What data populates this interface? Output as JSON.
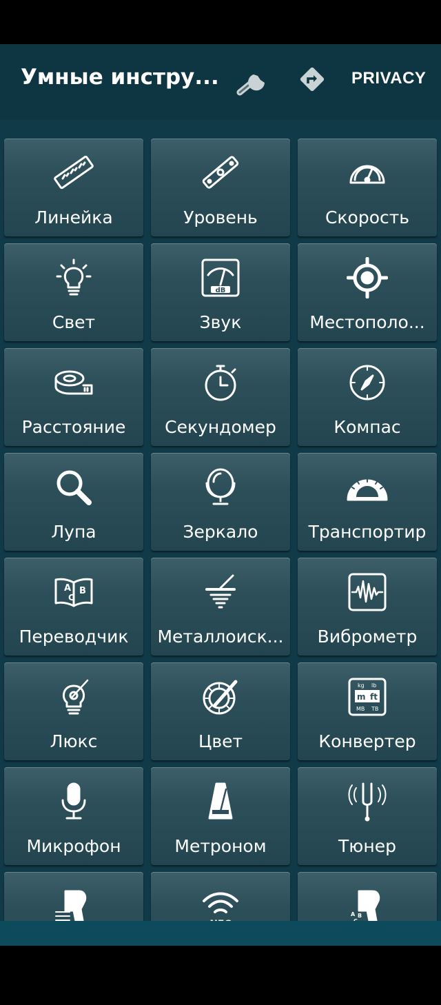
{
  "toolbar": {
    "title": "Умные инстру...",
    "settings_icon": "wrench-icon",
    "directions_icon": "directions-icon",
    "privacy_label": "PRIVACY"
  },
  "tools": [
    {
      "label": "Линейка",
      "icon": "ruler-icon"
    },
    {
      "label": "Уровень",
      "icon": "level-icon"
    },
    {
      "label": "Скорость",
      "icon": "speedometer-icon"
    },
    {
      "label": "Свет",
      "icon": "lightbulb-icon"
    },
    {
      "label": "Звук",
      "icon": "sound-meter-icon"
    },
    {
      "label": "Местополо...",
      "icon": "location-icon"
    },
    {
      "label": "Расстояние",
      "icon": "tape-measure-icon"
    },
    {
      "label": "Секундомер",
      "icon": "stopwatch-icon"
    },
    {
      "label": "Компас",
      "icon": "compass-icon"
    },
    {
      "label": "Лупа",
      "icon": "magnifier-icon"
    },
    {
      "label": "Зеркало",
      "icon": "mirror-icon"
    },
    {
      "label": "Транспортир",
      "icon": "protractor-icon"
    },
    {
      "label": "Переводчик",
      "icon": "translator-book-icon"
    },
    {
      "label": "Металлоиск...",
      "icon": "metal-detector-icon"
    },
    {
      "label": "Виброметр",
      "icon": "vibrometer-icon"
    },
    {
      "label": "Люкс",
      "icon": "lux-meter-icon"
    },
    {
      "label": "Цвет",
      "icon": "color-picker-icon"
    },
    {
      "label": "Конвертер",
      "icon": "converter-icon"
    },
    {
      "label": "Микрофон",
      "icon": "microphone-icon"
    },
    {
      "label": "Метроном",
      "icon": "metronome-icon"
    },
    {
      "label": "Тюнер",
      "icon": "tuning-fork-icon"
    },
    {
      "label": "",
      "icon": "barcode-scanner-icon"
    },
    {
      "label": "",
      "icon": "nfc-icon"
    },
    {
      "label": "",
      "icon": "text-scanner-icon"
    }
  ],
  "icon_texts": {
    "sound_unit": "dB",
    "nfc": "NFC",
    "book_a": "A",
    "book_b": "B",
    "book_c": "C",
    "conv_kg": "kg",
    "conv_lb": "lb",
    "conv_m": "m",
    "conv_ft": "ft",
    "conv_mb": "MB",
    "conv_tb": "TB"
  },
  "colors": {
    "background": "#113a48",
    "tile": "#2d4f59",
    "bottom_bar": "#0d4a5c"
  }
}
